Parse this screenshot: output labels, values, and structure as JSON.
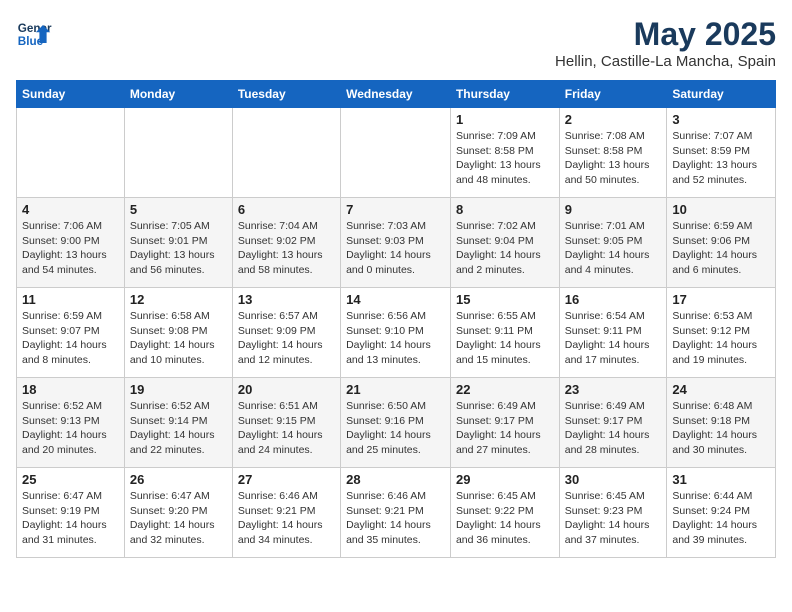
{
  "logo": {
    "line1": "General",
    "line2": "Blue"
  },
  "title": "May 2025",
  "location": "Hellin, Castille-La Mancha, Spain",
  "days_of_week": [
    "Sunday",
    "Monday",
    "Tuesday",
    "Wednesday",
    "Thursday",
    "Friday",
    "Saturday"
  ],
  "weeks": [
    [
      {
        "day": "",
        "info": ""
      },
      {
        "day": "",
        "info": ""
      },
      {
        "day": "",
        "info": ""
      },
      {
        "day": "",
        "info": ""
      },
      {
        "day": "1",
        "info": "Sunrise: 7:09 AM\nSunset: 8:58 PM\nDaylight: 13 hours\nand 48 minutes."
      },
      {
        "day": "2",
        "info": "Sunrise: 7:08 AM\nSunset: 8:58 PM\nDaylight: 13 hours\nand 50 minutes."
      },
      {
        "day": "3",
        "info": "Sunrise: 7:07 AM\nSunset: 8:59 PM\nDaylight: 13 hours\nand 52 minutes."
      }
    ],
    [
      {
        "day": "4",
        "info": "Sunrise: 7:06 AM\nSunset: 9:00 PM\nDaylight: 13 hours\nand 54 minutes."
      },
      {
        "day": "5",
        "info": "Sunrise: 7:05 AM\nSunset: 9:01 PM\nDaylight: 13 hours\nand 56 minutes."
      },
      {
        "day": "6",
        "info": "Sunrise: 7:04 AM\nSunset: 9:02 PM\nDaylight: 13 hours\nand 58 minutes."
      },
      {
        "day": "7",
        "info": "Sunrise: 7:03 AM\nSunset: 9:03 PM\nDaylight: 14 hours\nand 0 minutes."
      },
      {
        "day": "8",
        "info": "Sunrise: 7:02 AM\nSunset: 9:04 PM\nDaylight: 14 hours\nand 2 minutes."
      },
      {
        "day": "9",
        "info": "Sunrise: 7:01 AM\nSunset: 9:05 PM\nDaylight: 14 hours\nand 4 minutes."
      },
      {
        "day": "10",
        "info": "Sunrise: 6:59 AM\nSunset: 9:06 PM\nDaylight: 14 hours\nand 6 minutes."
      }
    ],
    [
      {
        "day": "11",
        "info": "Sunrise: 6:59 AM\nSunset: 9:07 PM\nDaylight: 14 hours\nand 8 minutes."
      },
      {
        "day": "12",
        "info": "Sunrise: 6:58 AM\nSunset: 9:08 PM\nDaylight: 14 hours\nand 10 minutes."
      },
      {
        "day": "13",
        "info": "Sunrise: 6:57 AM\nSunset: 9:09 PM\nDaylight: 14 hours\nand 12 minutes."
      },
      {
        "day": "14",
        "info": "Sunrise: 6:56 AM\nSunset: 9:10 PM\nDaylight: 14 hours\nand 13 minutes."
      },
      {
        "day": "15",
        "info": "Sunrise: 6:55 AM\nSunset: 9:11 PM\nDaylight: 14 hours\nand 15 minutes."
      },
      {
        "day": "16",
        "info": "Sunrise: 6:54 AM\nSunset: 9:11 PM\nDaylight: 14 hours\nand 17 minutes."
      },
      {
        "day": "17",
        "info": "Sunrise: 6:53 AM\nSunset: 9:12 PM\nDaylight: 14 hours\nand 19 minutes."
      }
    ],
    [
      {
        "day": "18",
        "info": "Sunrise: 6:52 AM\nSunset: 9:13 PM\nDaylight: 14 hours\nand 20 minutes."
      },
      {
        "day": "19",
        "info": "Sunrise: 6:52 AM\nSunset: 9:14 PM\nDaylight: 14 hours\nand 22 minutes."
      },
      {
        "day": "20",
        "info": "Sunrise: 6:51 AM\nSunset: 9:15 PM\nDaylight: 14 hours\nand 24 minutes."
      },
      {
        "day": "21",
        "info": "Sunrise: 6:50 AM\nSunset: 9:16 PM\nDaylight: 14 hours\nand 25 minutes."
      },
      {
        "day": "22",
        "info": "Sunrise: 6:49 AM\nSunset: 9:17 PM\nDaylight: 14 hours\nand 27 minutes."
      },
      {
        "day": "23",
        "info": "Sunrise: 6:49 AM\nSunset: 9:17 PM\nDaylight: 14 hours\nand 28 minutes."
      },
      {
        "day": "24",
        "info": "Sunrise: 6:48 AM\nSunset: 9:18 PM\nDaylight: 14 hours\nand 30 minutes."
      }
    ],
    [
      {
        "day": "25",
        "info": "Sunrise: 6:47 AM\nSunset: 9:19 PM\nDaylight: 14 hours\nand 31 minutes."
      },
      {
        "day": "26",
        "info": "Sunrise: 6:47 AM\nSunset: 9:20 PM\nDaylight: 14 hours\nand 32 minutes."
      },
      {
        "day": "27",
        "info": "Sunrise: 6:46 AM\nSunset: 9:21 PM\nDaylight: 14 hours\nand 34 minutes."
      },
      {
        "day": "28",
        "info": "Sunrise: 6:46 AM\nSunset: 9:21 PM\nDaylight: 14 hours\nand 35 minutes."
      },
      {
        "day": "29",
        "info": "Sunrise: 6:45 AM\nSunset: 9:22 PM\nDaylight: 14 hours\nand 36 minutes."
      },
      {
        "day": "30",
        "info": "Sunrise: 6:45 AM\nSunset: 9:23 PM\nDaylight: 14 hours\nand 37 minutes."
      },
      {
        "day": "31",
        "info": "Sunrise: 6:44 AM\nSunset: 9:24 PM\nDaylight: 14 hours\nand 39 minutes."
      }
    ]
  ]
}
